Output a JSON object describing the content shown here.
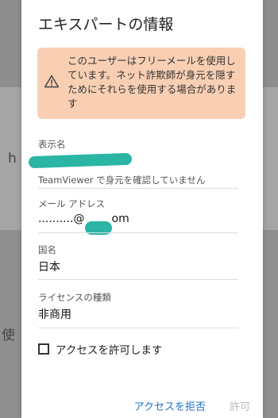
{
  "dialog": {
    "title": "エキスパートの情報",
    "warning": {
      "icon": "warning-icon",
      "text": "このユーザーはフリーメールを使用しています。ネット詐欺師が身元を隠すためにそれらを使用する場合があります"
    },
    "fields": {
      "display_name": {
        "label": "表示名",
        "value": "",
        "note": "TeamViewer で身元を確認していません"
      },
      "email": {
        "label": "メール アドレス",
        "value_prefix": "..........@",
        "value_suffix": "om"
      },
      "country": {
        "label": "国名",
        "value": "日本"
      },
      "license": {
        "label": "ライセンスの種類",
        "value": "非商用"
      }
    },
    "allow_access": {
      "checked": false,
      "label": "アクセスを許可します"
    },
    "buttons": {
      "deny": "アクセスを拒否",
      "allow": "許可"
    },
    "colors": {
      "warning_bg": "#f8cfb3",
      "accent": "#1e72c8",
      "redaction": "#2ab5a5"
    }
  },
  "background": {
    "fragment_1": "h",
    "fragment_2": "使"
  }
}
